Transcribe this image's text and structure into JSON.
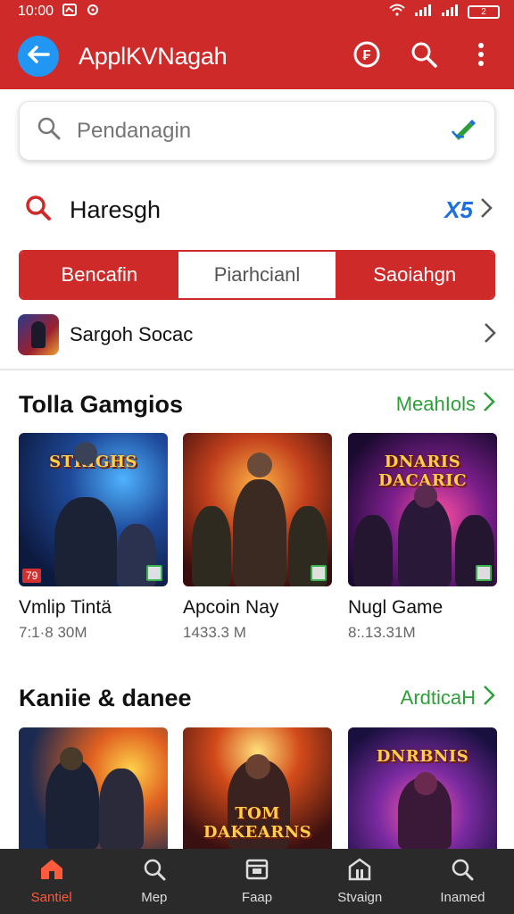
{
  "status_bar": {
    "time": "10:00",
    "battery": "2"
  },
  "app_bar": {
    "title": "ApplKVNagah",
    "back_icon": "back-arrow-icon",
    "actions": [
      "coin-icon",
      "search-icon",
      "more-vert-icon"
    ]
  },
  "search": {
    "placeholder": "Pendanagin",
    "value": ""
  },
  "filter": {
    "title": "Haresgh",
    "count": "X5"
  },
  "segments": [
    "Bencafin",
    "Piarhcianl",
    "Saoiahgn"
  ],
  "featured": {
    "label": "Sargoh Socac"
  },
  "sections": [
    {
      "title": "Tolla Gamgios",
      "link": "MeahIols",
      "items": [
        {
          "name": "Vmlip Tintä",
          "size": "7:1·8 30M",
          "art_text": "STRIGHS",
          "badge": "79"
        },
        {
          "name": "Apcoin Nay",
          "size": "1433.3 M",
          "art_text": "",
          "badge": ""
        },
        {
          "name": "Nugl Game",
          "size": "8:.13.31M",
          "art_text": "DNARIS DACARIC",
          "badge": ""
        }
      ]
    },
    {
      "title": "Kaniie & danee",
      "link": "ArdticaH",
      "items": [
        {
          "art_text": ""
        },
        {
          "art_text": "TOM DAKEARNS"
        },
        {
          "art_text": "DNRBNIS"
        }
      ]
    }
  ],
  "bottom_nav": [
    {
      "label": "Santiel",
      "icon": "home-icon"
    },
    {
      "label": "Mep",
      "icon": "search-icon"
    },
    {
      "label": "Faap",
      "icon": "folder-icon"
    },
    {
      "label": "Stvaign",
      "icon": "store-icon"
    },
    {
      "label": "Inamed",
      "icon": "search-icon"
    }
  ],
  "colors": {
    "primary": "#cf2a2a",
    "accent_blue": "#2196f3",
    "link_green": "#2e9e3a",
    "nav_bg": "#2a2a2a",
    "nav_active": "#ff5a3c"
  }
}
